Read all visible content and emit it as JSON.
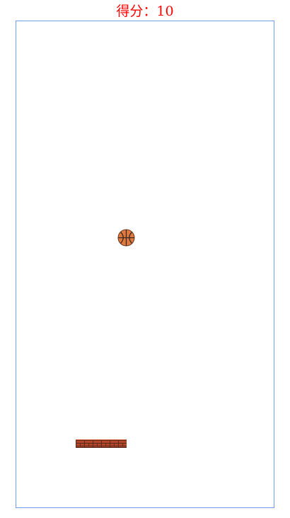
{
  "hud": {
    "score_label": "得分：",
    "score_value": "10"
  },
  "colors": {
    "score_text": "#ff0000",
    "board_border": "#6f9fea",
    "ball": "#e07a3f",
    "paddle": "#b5462a"
  },
  "sprites": {
    "ball": "basketball-icon",
    "paddle": "brick-paddle"
  }
}
